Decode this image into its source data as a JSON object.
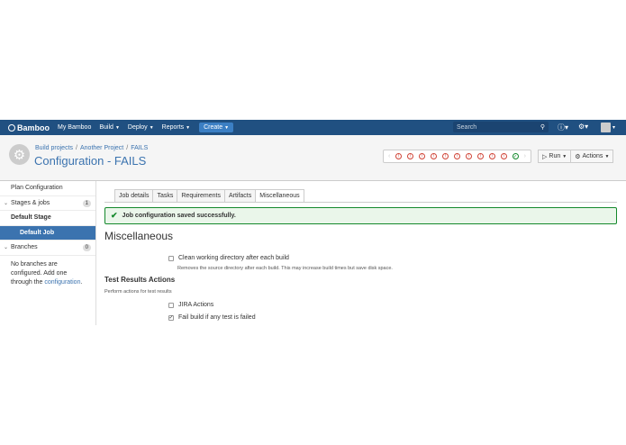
{
  "topbar": {
    "logo_text": "Bamboo",
    "my_bamboo": "My Bamboo",
    "build": "Build",
    "deploy": "Deploy",
    "reports": "Reports",
    "create": "Create",
    "search_placeholder": "Search",
    "help_icon": "question-icon",
    "settings_icon": "gear-icon"
  },
  "header": {
    "breadcrumb": [
      "Build projects",
      "Another Project",
      "FAILS"
    ],
    "title": "Configuration - FAILS",
    "run_label": "Run",
    "actions_label": "Actions",
    "build_statuses": [
      "fail",
      "fail",
      "fail",
      "fail",
      "fail",
      "fail",
      "fail",
      "fail",
      "fail",
      "fail",
      "success"
    ]
  },
  "sidebar": {
    "plan_configuration": "Plan Configuration",
    "stages_jobs": "Stages & jobs",
    "stages_count": "1",
    "default_stage": "Default Stage",
    "default_job": "Default Job",
    "branches": "Branches",
    "branches_count": "0",
    "no_branches_text": "No branches are configured. Add one through the",
    "configuration_link": "configuration",
    "period": "."
  },
  "tabs": [
    "Job details",
    "Tasks",
    "Requirements",
    "Artifacts",
    "Miscellaneous"
  ],
  "message": "Job configuration saved successfully.",
  "main": {
    "heading": "Miscellaneous",
    "clean_label": "Clean working directory after each build",
    "clean_desc": "Removes the source directory after each build. This may increase build times but save disk space.",
    "test_heading": "Test Results Actions",
    "test_desc": "Perform actions for test results",
    "jira_label": "JIRA Actions",
    "fail_label": "Fail build if any test is failed"
  },
  "colors": {
    "nav": "#205081",
    "link": "#3b73af",
    "success": "#14892c",
    "error": "#d04437"
  }
}
